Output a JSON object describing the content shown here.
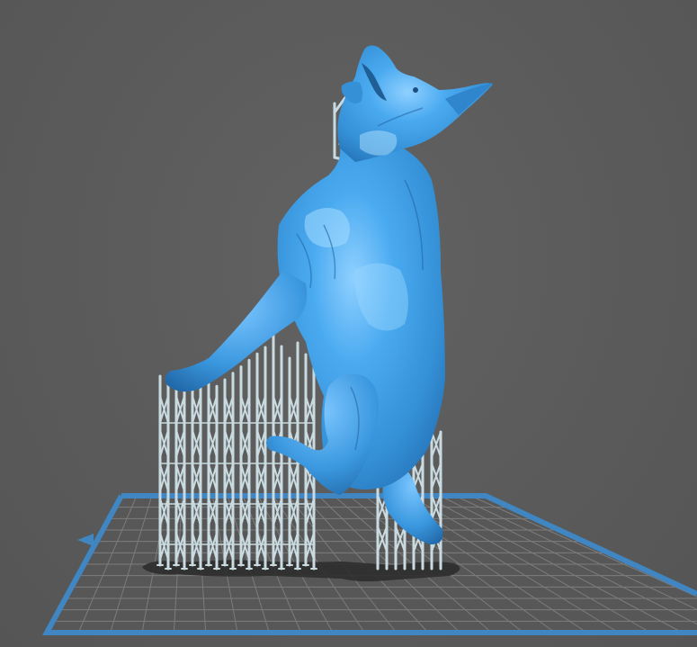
{
  "viewport": {
    "background_color": "#5b5b5b",
    "content": "slicer-3d-view"
  },
  "build_plate": {
    "grid": true,
    "border_color": "#3f86c2",
    "grid_color": "#7c7c7c",
    "plate_color": "#555555"
  },
  "model": {
    "icon": "howling-dog-model",
    "color": "#3d9de0",
    "highlight_color": "#8fd0ff"
  },
  "supports": {
    "color": "#c9dbe0",
    "raft_color": "#2e2e2e"
  }
}
